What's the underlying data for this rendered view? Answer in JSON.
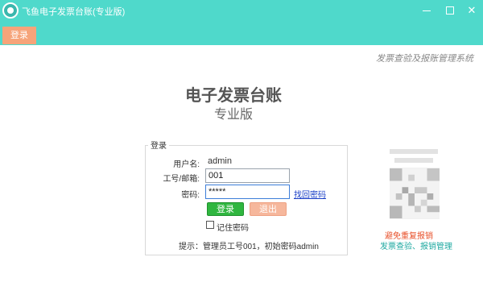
{
  "window": {
    "title": "飞鱼电子发票台账(专业版)",
    "controls": {
      "minimize": "",
      "maximize": "",
      "close": "✕"
    },
    "accent_color": "#4fd9cb"
  },
  "tabs": [
    {
      "label": "登录",
      "color": "#f6a47a"
    }
  ],
  "header": {
    "tagline": "发票查验及报账管理系统",
    "title": "电子发票台账",
    "edition": "专业版"
  },
  "login": {
    "group_label": "登录",
    "username_label": "用户名:",
    "username_value": "admin",
    "account_label": "工号/邮箱:",
    "account_value": "001",
    "password_label": "密码:",
    "password_value": "*****",
    "forgot_link": "找回密码",
    "login_button": "登录",
    "exit_button": "退出",
    "remember_label": "记住密码",
    "remember_checked": false,
    "hint": "提示：管理员工号001，初始密码admin"
  },
  "promo": {
    "qr_icon": "qr-code-icon",
    "red_note": "避免重复报销",
    "teal_note": "发票查验、报销管理"
  }
}
